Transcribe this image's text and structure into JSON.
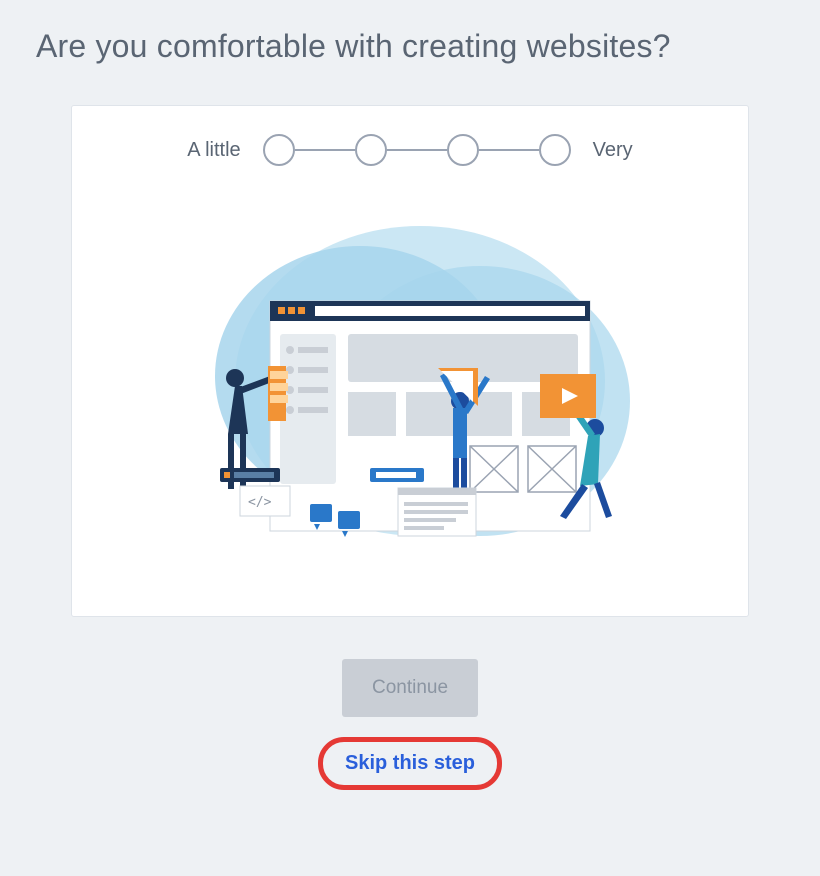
{
  "question": "Are you comfortable with creating websites?",
  "scale": {
    "min_label": "A little",
    "max_label": "Very",
    "steps": 4
  },
  "buttons": {
    "continue": "Continue",
    "skip": "Skip this step"
  },
  "illustration": {
    "name": "people-building-website"
  },
  "colors": {
    "background": "#eef1f4",
    "text_muted": "#5a6573",
    "ring_gray": "#9aa3b2",
    "btn_disabled_bg": "#c9ced5",
    "btn_disabled_text": "#8b95a2",
    "link": "#2a5fdb",
    "highlight_ring": "#e53935",
    "blob_light": "#cbe7f4",
    "blob_mid": "#a7d5ec",
    "browser_bar": "#1d3557",
    "accent_orange": "#f29335",
    "blue": "#2a78c9",
    "dark_blue": "#1c4c9e"
  }
}
